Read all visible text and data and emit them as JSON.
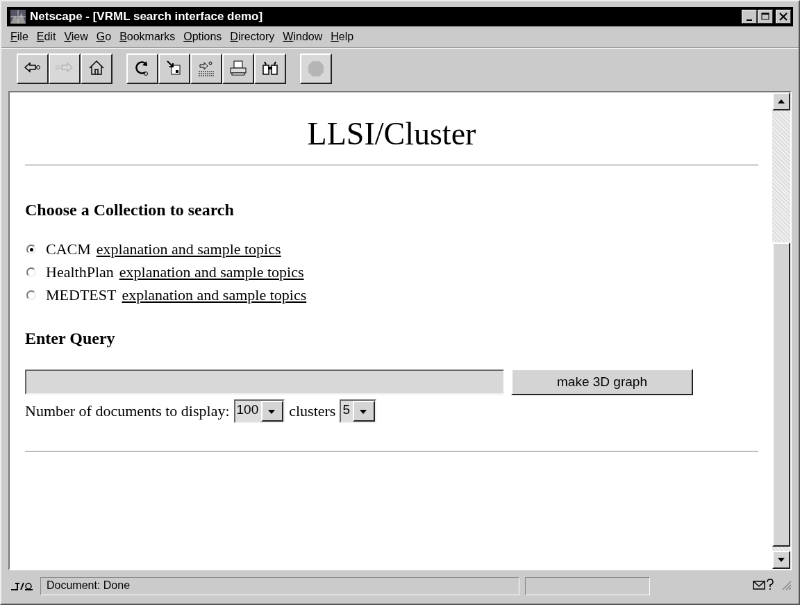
{
  "window": {
    "title": "Netscape - [VRML search interface demo]"
  },
  "menu": [
    {
      "label": "File"
    },
    {
      "label": "Edit"
    },
    {
      "label": "View"
    },
    {
      "label": "Go"
    },
    {
      "label": "Bookmarks"
    },
    {
      "label": "Options"
    },
    {
      "label": "Directory"
    },
    {
      "label": "Window"
    },
    {
      "label": "Help"
    }
  ],
  "toolbar": [
    {
      "kind": "back",
      "disabled": false
    },
    {
      "kind": "forward",
      "disabled": true
    },
    {
      "kind": "home",
      "disabled": false
    },
    {
      "kind": "reload",
      "disabled": false
    },
    {
      "kind": "images",
      "disabled": false
    },
    {
      "kind": "open",
      "disabled": false
    },
    {
      "kind": "print",
      "disabled": false
    },
    {
      "kind": "find",
      "disabled": false
    },
    {
      "kind": "stop",
      "disabled": true
    }
  ],
  "page": {
    "title": "LLSI/Cluster",
    "collection_heading": "Choose a Collection to search",
    "collections": [
      {
        "label": "CACM",
        "link": "explanation and sample topics",
        "selected": true
      },
      {
        "label": "HealthPlan",
        "link": "explanation and sample topics",
        "selected": false
      },
      {
        "label": "MEDTEST",
        "link": "explanation and sample topics",
        "selected": false
      }
    ],
    "query_heading": "Enter Query",
    "submit_button": "make 3D graph",
    "documents_label": "Number of documents to display:",
    "documents_select": "100",
    "clusters_label": "clusters",
    "clusters_select": "5"
  },
  "status_bar": {
    "text": "Document: Done"
  }
}
